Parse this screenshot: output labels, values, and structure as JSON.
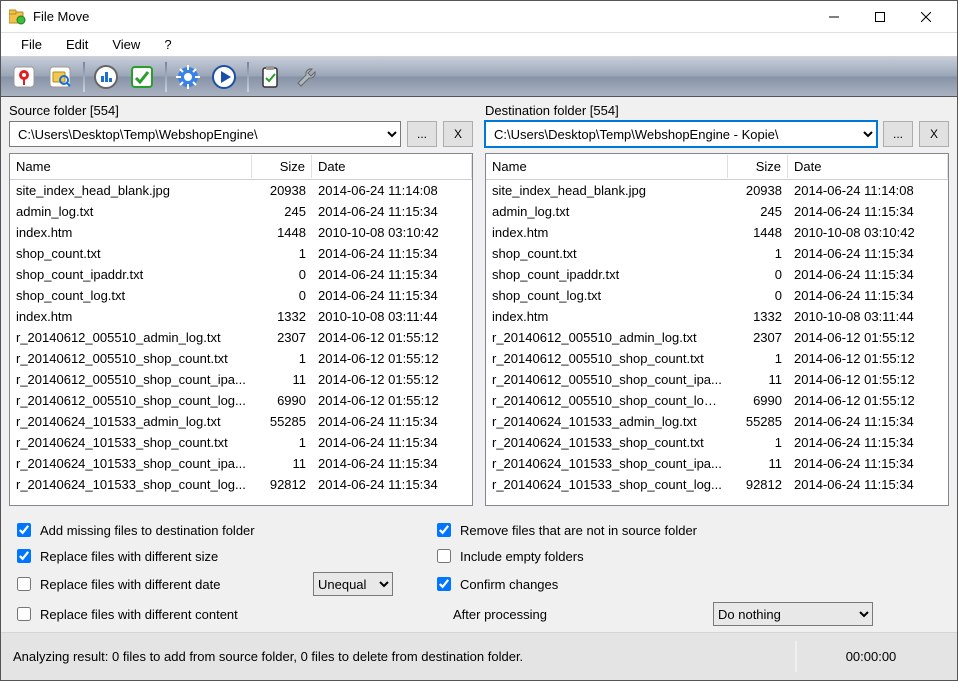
{
  "window": {
    "title": "File Move"
  },
  "menu": {
    "file": "File",
    "edit": "Edit",
    "view": "View",
    "help": "?"
  },
  "toolbar": {
    "b1": "pin-icon",
    "b2": "drive-search-icon",
    "b3": "analyze-icon",
    "b4": "sync-icon",
    "b5": "settings-gear-icon",
    "b6": "play-icon",
    "b7": "clipboard-icon",
    "b8": "wrench-icon"
  },
  "source": {
    "label": "Source folder [554]",
    "path": "C:\\Users\\Desktop\\Temp\\WebshopEngine\\",
    "browse": "...",
    "clear": "X"
  },
  "dest": {
    "label": "Destination folder [554]",
    "path": "C:\\Users\\Desktop\\Temp\\WebshopEngine - Kopie\\",
    "browse": "...",
    "clear": "X"
  },
  "columns": {
    "name": "Name",
    "size": "Size",
    "date": "Date"
  },
  "files": [
    {
      "name": "site_index_head_blank.jpg",
      "size": "20938",
      "date": "2014-06-24 11:14:08"
    },
    {
      "name": "admin_log.txt",
      "size": "245",
      "date": "2014-06-24 11:15:34"
    },
    {
      "name": "index.htm",
      "size": "1448",
      "date": "2010-10-08 03:10:42"
    },
    {
      "name": "shop_count.txt",
      "size": "1",
      "date": "2014-06-24 11:15:34"
    },
    {
      "name": "shop_count_ipaddr.txt",
      "size": "0",
      "date": "2014-06-24 11:15:34"
    },
    {
      "name": "shop_count_log.txt",
      "size": "0",
      "date": "2014-06-24 11:15:34"
    },
    {
      "name": "index.htm",
      "size": "1332",
      "date": "2010-10-08 03:11:44"
    },
    {
      "name": "r_20140612_005510_admin_log.txt",
      "size": "2307",
      "date": "2014-06-12 01:55:12"
    },
    {
      "name": "r_20140612_005510_shop_count.txt",
      "size": "1",
      "date": "2014-06-12 01:55:12"
    },
    {
      "name": "r_20140612_005510_shop_count_ipa...",
      "size": "11",
      "date": "2014-06-12 01:55:12"
    },
    {
      "name": "r_20140612_005510_shop_count_log...",
      "size": "6990",
      "date": "2014-06-12 01:55:12"
    },
    {
      "name": "r_20140624_101533_admin_log.txt",
      "size": "55285",
      "date": "2014-06-24 11:15:34"
    },
    {
      "name": "r_20140624_101533_shop_count.txt",
      "size": "1",
      "date": "2014-06-24 11:15:34"
    },
    {
      "name": "r_20140624_101533_shop_count_ipa...",
      "size": "11",
      "date": "2014-06-24 11:15:34"
    },
    {
      "name": "r_20140624_101533_shop_count_log...",
      "size": "92812",
      "date": "2014-06-24 11:15:34"
    }
  ],
  "files2": [
    {
      "name": "site_index_head_blank.jpg",
      "size": "20938",
      "date": "2014-06-24 11:14:08"
    },
    {
      "name": "admin_log.txt",
      "size": "245",
      "date": "2014-06-24 11:15:34"
    },
    {
      "name": "index.htm",
      "size": "1448",
      "date": "2010-10-08 03:10:42"
    },
    {
      "name": "shop_count.txt",
      "size": "1",
      "date": "2014-06-24 11:15:34"
    },
    {
      "name": "shop_count_ipaddr.txt",
      "size": "0",
      "date": "2014-06-24 11:15:34"
    },
    {
      "name": "shop_count_log.txt",
      "size": "0",
      "date": "2014-06-24 11:15:34"
    },
    {
      "name": "index.htm",
      "size": "1332",
      "date": "2010-10-08 03:11:44"
    },
    {
      "name": "r_20140612_005510_admin_log.txt",
      "size": "2307",
      "date": "2014-06-12 01:55:12"
    },
    {
      "name": "r_20140612_005510_shop_count.txt",
      "size": "1",
      "date": "2014-06-12 01:55:12"
    },
    {
      "name": "r_20140612_005510_shop_count_ipa...",
      "size": "11",
      "date": "2014-06-12 01:55:12"
    },
    {
      "name": "r_20140612_005510_shop_count_log....",
      "size": "6990",
      "date": "2014-06-12 01:55:12"
    },
    {
      "name": "r_20140624_101533_admin_log.txt",
      "size": "55285",
      "date": "2014-06-24 11:15:34"
    },
    {
      "name": "r_20140624_101533_shop_count.txt",
      "size": "1",
      "date": "2014-06-24 11:15:34"
    },
    {
      "name": "r_20140624_101533_shop_count_ipa...",
      "size": "11",
      "date": "2014-06-24 11:15:34"
    },
    {
      "name": "r_20140624_101533_shop_count_log...",
      "size": "92812",
      "date": "2014-06-24 11:15:34"
    }
  ],
  "opts": {
    "add_missing": "Add missing files to destination folder",
    "replace_size": "Replace files with different size",
    "replace_date": "Replace files with different date",
    "replace_content": "Replace files with different content",
    "remove_not_source": "Remove files that are not in source folder",
    "include_empty": "Include empty folders",
    "confirm": "Confirm changes",
    "date_mode": "Unequal",
    "after_label": "After processing",
    "after_value": "Do nothing"
  },
  "status": {
    "msg": "Analyzing result: 0 files to add from source folder, 0 files to delete from destination folder.",
    "time": "00:00:00"
  }
}
